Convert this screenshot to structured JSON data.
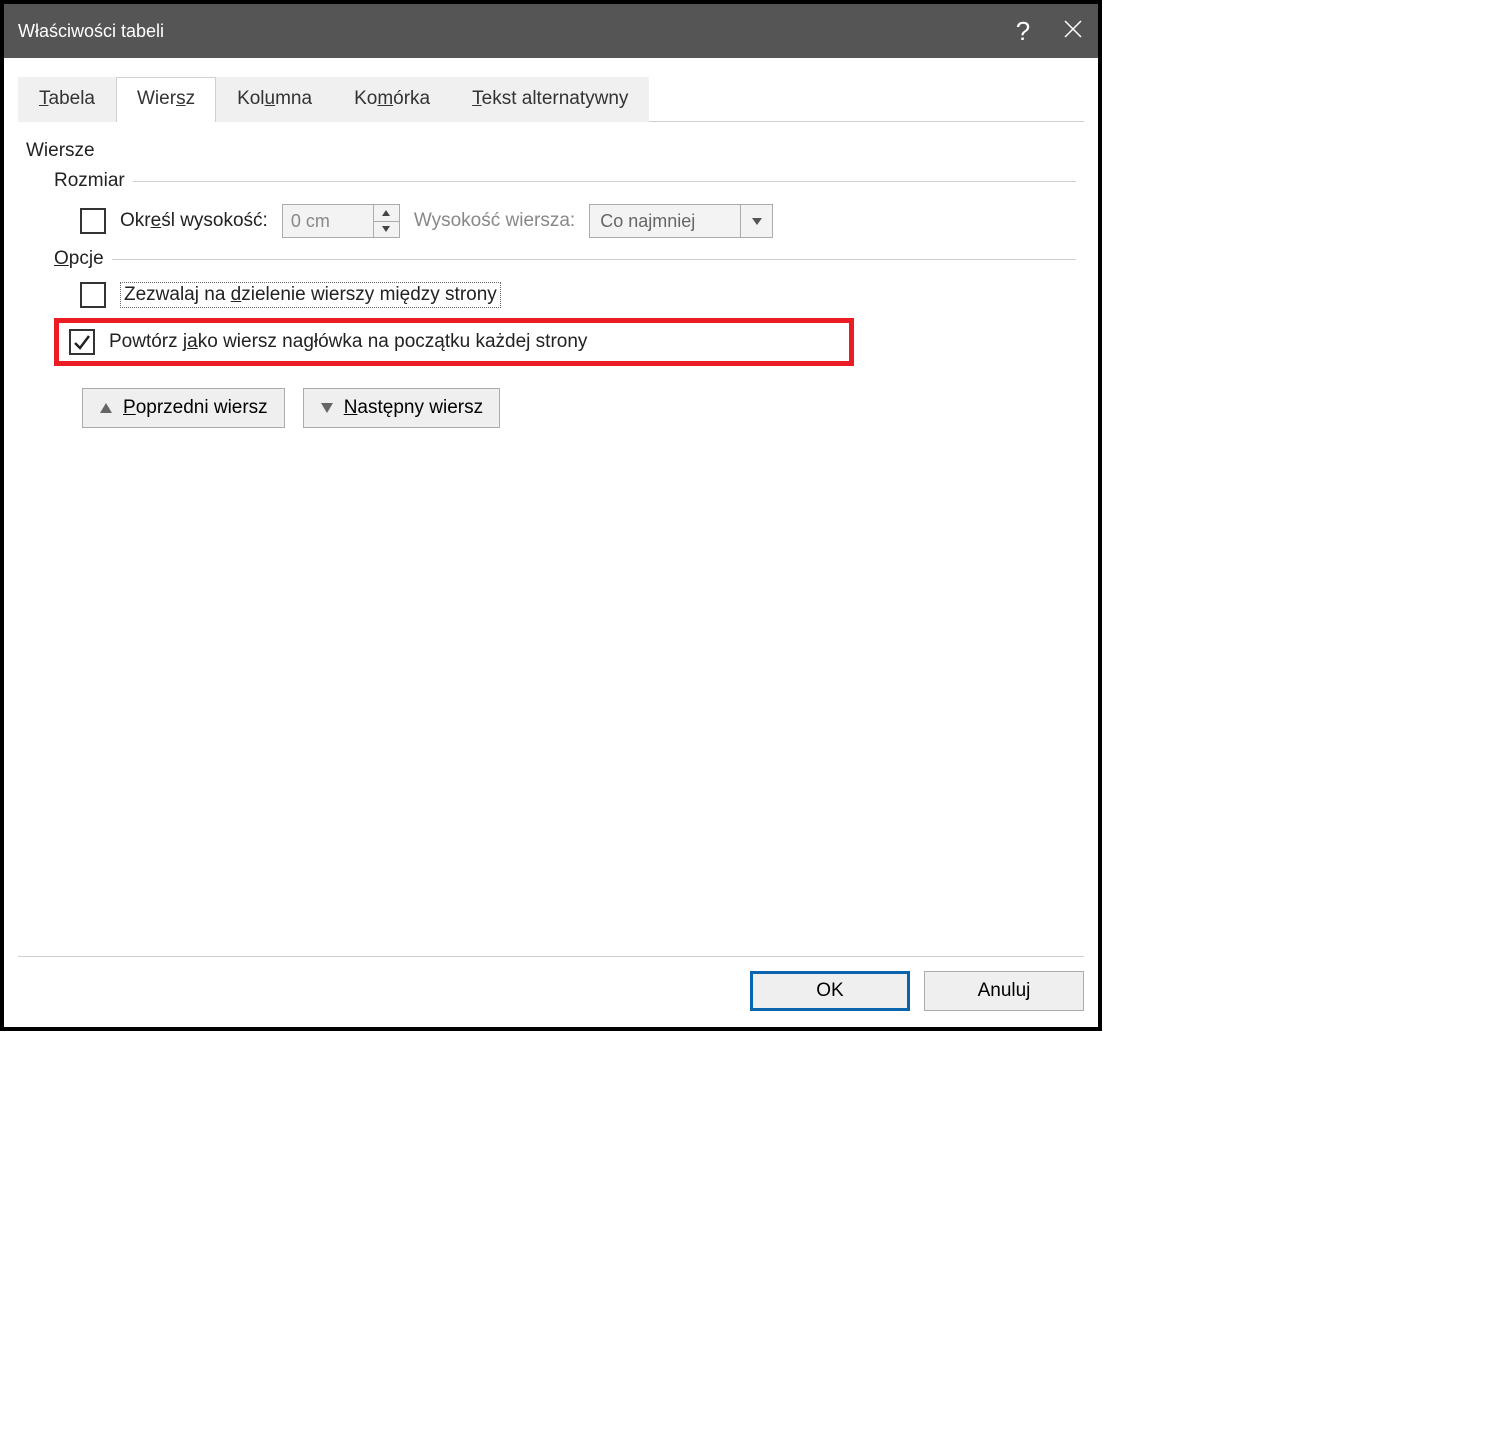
{
  "title": "Właściwości tabeli",
  "tabs": {
    "tabela": {
      "pre": "",
      "u": "T",
      "post": "abela"
    },
    "wiersz": {
      "pre": "Wier",
      "u": "s",
      "post": "z"
    },
    "kolumna": {
      "pre": "Kol",
      "u": "u",
      "post": "mna"
    },
    "komorka": {
      "pre": "Ko",
      "u": "m",
      "post": "órka"
    },
    "alttext": {
      "pre": "",
      "u": "T",
      "post": "ekst alternatywny"
    }
  },
  "panel": {
    "heading": "Wiersze",
    "size": {
      "legend": "Rozmiar",
      "specify_height": {
        "pre": "Okr",
        "u": "e",
        "post": "śl wysokość:"
      },
      "height_value": "0 cm",
      "row_height_label": "Wysokość wiersza:",
      "row_height_value": "Co najmniej"
    },
    "options": {
      "legend": {
        "pre": "",
        "u": "O",
        "post": "pcje"
      },
      "allow_break": {
        "pre": "Zezwalaj na ",
        "u": "d",
        "post": "zielenie wierszy między strony"
      },
      "repeat_header": {
        "pre": "Powtórz j",
        "u": "a",
        "post": "ko wiersz nagłówka na początku każdej strony"
      }
    },
    "nav": {
      "prev": {
        "pre": "",
        "u": "P",
        "post": "oprzedni wiersz"
      },
      "next": {
        "pre": "",
        "u": "N",
        "post": "astępny wiersz"
      }
    }
  },
  "buttons": {
    "ok": "OK",
    "cancel": "Anuluj"
  }
}
